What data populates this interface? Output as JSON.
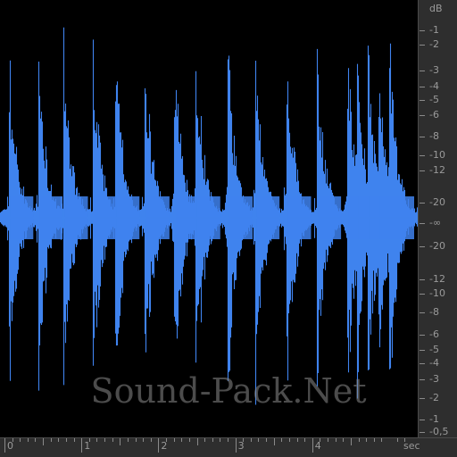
{
  "colors": {
    "background": "#000000",
    "waveform": "#3f83ee",
    "ruler_background": "#2e2e2e",
    "ruler_text": "#9a9a9a"
  },
  "db_ruler": {
    "unit_label": "dB",
    "labels": [
      "-1",
      "-2",
      "-3",
      "-4",
      "-5",
      "-6",
      "-8",
      "-10",
      "-12",
      "-20",
      "-∞",
      "-20",
      "-12",
      "-10",
      "-8",
      "-6",
      "-5",
      "-4",
      "-3",
      "-2",
      "-1",
      "-0,5"
    ]
  },
  "time_ruler": {
    "unit_label": "sec",
    "labels": [
      "0",
      "1",
      "2",
      "3",
      "4"
    ]
  },
  "watermark": "Sound-Pack.Net",
  "waveform": {
    "channels": 1,
    "hits_seconds": [
      0.05,
      0.43,
      0.76,
      1.14,
      1.43,
      1.82,
      2.2,
      2.48,
      2.9,
      3.25,
      3.66,
      4.05,
      4.45,
      4.58,
      4.72,
      4.85,
      5.0
    ]
  }
}
